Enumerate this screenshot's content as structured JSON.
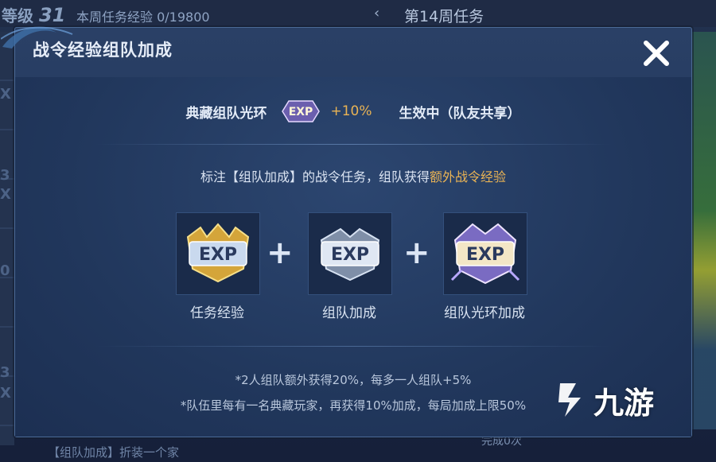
{
  "background": {
    "level_label": "等级",
    "level_value": "31",
    "weekly_exp": "本周任务经验 0/19800",
    "week_title": "第14周任务",
    "side_digits": [
      "X",
      "3",
      "X",
      "0",
      "3",
      "X"
    ],
    "bottom_left": "【组队加成】折装一个家",
    "bottom_right": "完成0次"
  },
  "modal": {
    "title": "战令经验组队加成",
    "close_icon": "close-icon",
    "aura": {
      "name": "典藏组队光环",
      "bonus": "+10%",
      "status": "生效中（队友共享）"
    },
    "description_prefix": "标注【组队加成】的战令任务，组队获得",
    "description_highlight": "额外战令经验",
    "exp_items": [
      {
        "label": "任务经验",
        "icon": "gold-exp-icon"
      },
      {
        "label": "组队加成",
        "icon": "silver-exp-icon"
      },
      {
        "label": "组队光环加成",
        "icon": "crystal-exp-icon"
      }
    ],
    "plus": "+",
    "notes": [
      "*2人组队额外获得20%，每多一人组队+5%",
      "*队伍里每有一名典藏玩家，再获得10%加成，每局加成上限50%"
    ]
  },
  "watermark": {
    "text": "九游"
  },
  "colors": {
    "accent_gold": "#e9b354",
    "modal_bg": "#22385c",
    "text": "#dbe4f2"
  }
}
